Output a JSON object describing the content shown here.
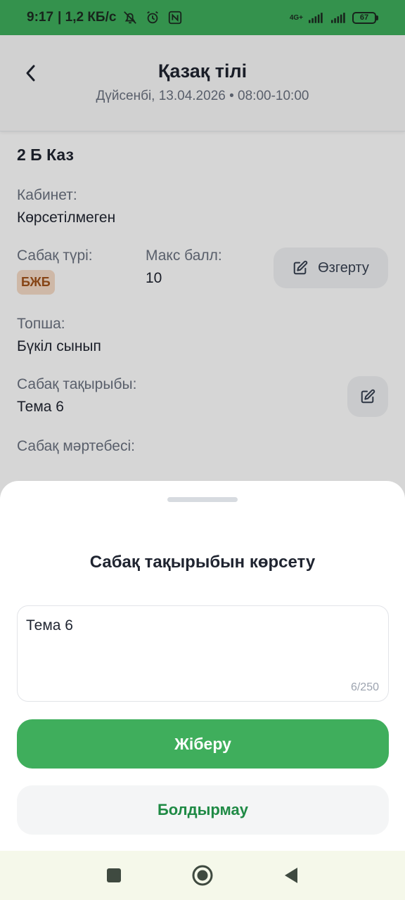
{
  "status_bar": {
    "time": "9:17",
    "speed": "| 1,2 КБ/с",
    "icons": [
      "mute-icon",
      "alarm-icon",
      "nfc-icon",
      "signal-icon",
      "signal-icon"
    ],
    "network_type": "4G+",
    "battery": "67",
    "background_color": "#3fae5c"
  },
  "header": {
    "title": "Қазақ тілі",
    "subtitle": "Дүйсенбі, 13.04.2026 • 08:00-10:00",
    "back_icon": "chevron-left-icon"
  },
  "lesson": {
    "class_name": "2 Б Каз",
    "cabinet_label": "Кабинет:",
    "cabinet_value": "Көрсетілмеген",
    "type_label": "Сабақ түрі:",
    "type_badge": "БЖБ",
    "max_label": "Макс балл:",
    "max_value": "10",
    "edit_label": "Өзгерту",
    "group_label": "Топша:",
    "group_value": "Бүкіл сынып",
    "topic_label": "Сабақ тақырыбы:",
    "topic_value": "Тема 6",
    "status_label": "Сабақ мәртебесі:"
  },
  "sheet": {
    "title": "Сабақ тақырыбын көрсету",
    "input_value": "Тема 6",
    "counter": "6/250",
    "submit_label": "Жіберу",
    "cancel_label": "Болдырмау",
    "accent_color": "#3fae5c"
  },
  "nav_bar": {
    "icons": [
      "recent-apps-icon",
      "home-icon",
      "back-icon"
    ]
  }
}
